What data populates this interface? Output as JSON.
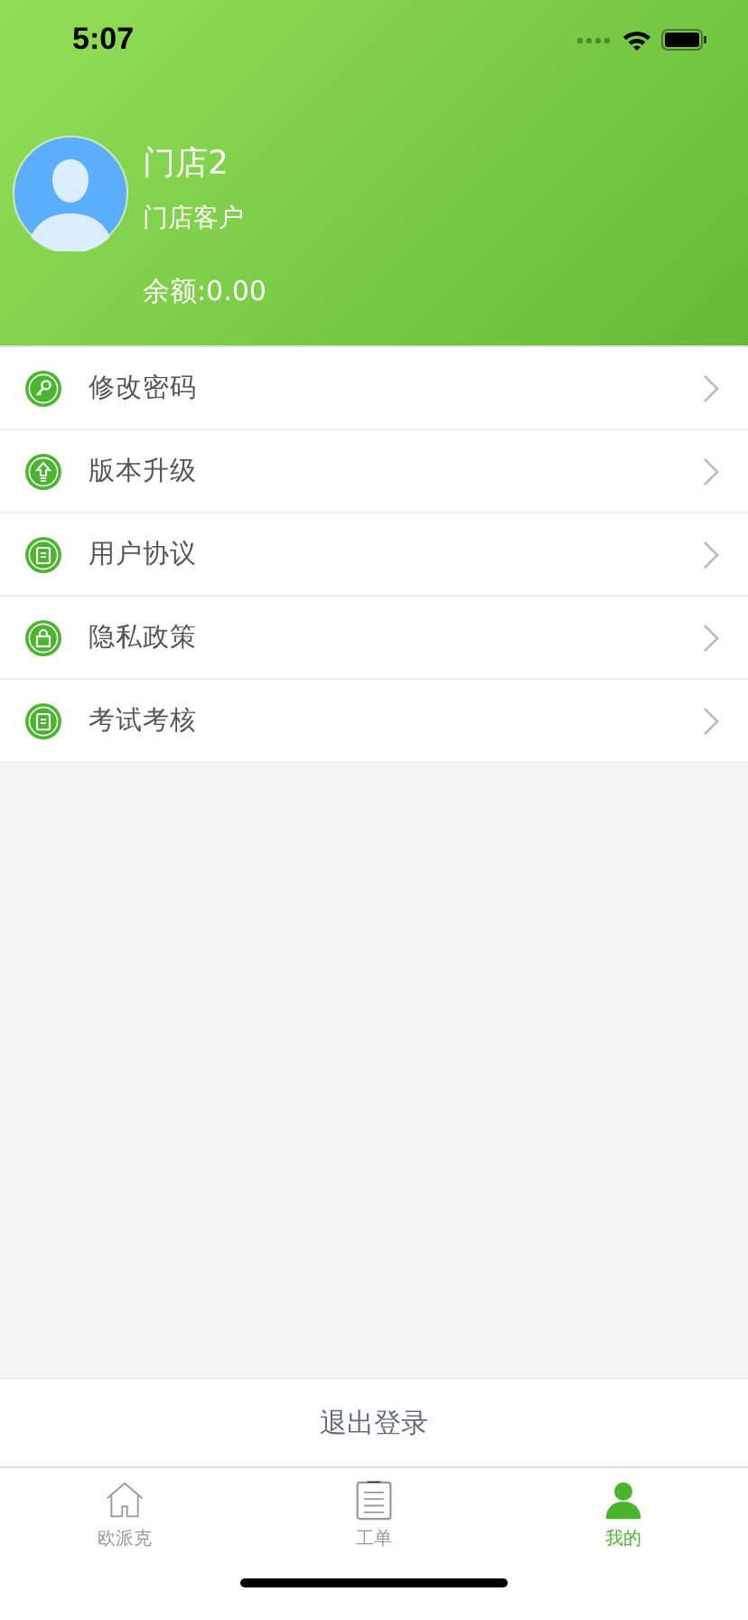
{
  "status_bar": {
    "time": "5:07"
  },
  "profile": {
    "name": "门店2",
    "role": "门店客户",
    "balance": "余额:0.00"
  },
  "menu": [
    {
      "kind": "key",
      "label": "修改密码"
    },
    {
      "kind": "upgrade",
      "label": "版本升级"
    },
    {
      "kind": "clipboard",
      "label": "用户协议"
    },
    {
      "kind": "lock",
      "label": "隐私政策"
    },
    {
      "kind": "clipboard",
      "label": "考试考核"
    }
  ],
  "logout_button": "退出登录",
  "tab_bar": [
    {
      "kind": "home",
      "label": "欧派克",
      "selected": false
    },
    {
      "kind": "list",
      "label": "工单",
      "selected": false
    },
    {
      "kind": "person",
      "label": "我的",
      "selected": true
    }
  ]
}
